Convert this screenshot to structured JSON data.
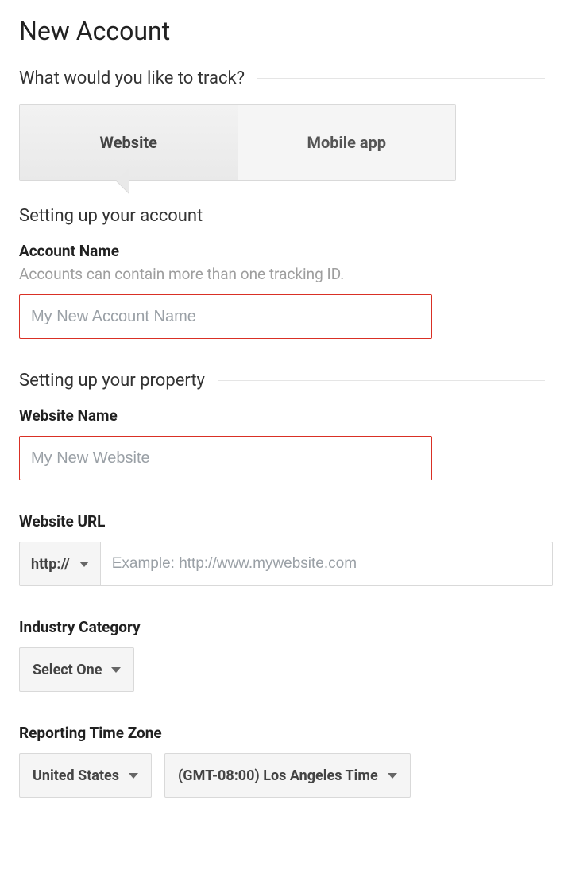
{
  "page": {
    "title": "New Account"
  },
  "track": {
    "heading": "What would you like to track?",
    "tabs": {
      "website": "Website",
      "mobile": "Mobile app"
    }
  },
  "account": {
    "heading": "Setting up your account",
    "name_label": "Account Name",
    "name_hint": "Accounts can contain more than one tracking ID.",
    "name_placeholder": "My New Account Name"
  },
  "property": {
    "heading": "Setting up your property",
    "website_name_label": "Website Name",
    "website_name_placeholder": "My New Website",
    "url_label": "Website URL",
    "protocol": "http://",
    "url_placeholder": "Example: http://www.mywebsite.com",
    "industry_label": "Industry Category",
    "industry_value": "Select One",
    "tz_label": "Reporting Time Zone",
    "tz_country": "United States",
    "tz_value": "(GMT-08:00) Los Angeles Time"
  }
}
